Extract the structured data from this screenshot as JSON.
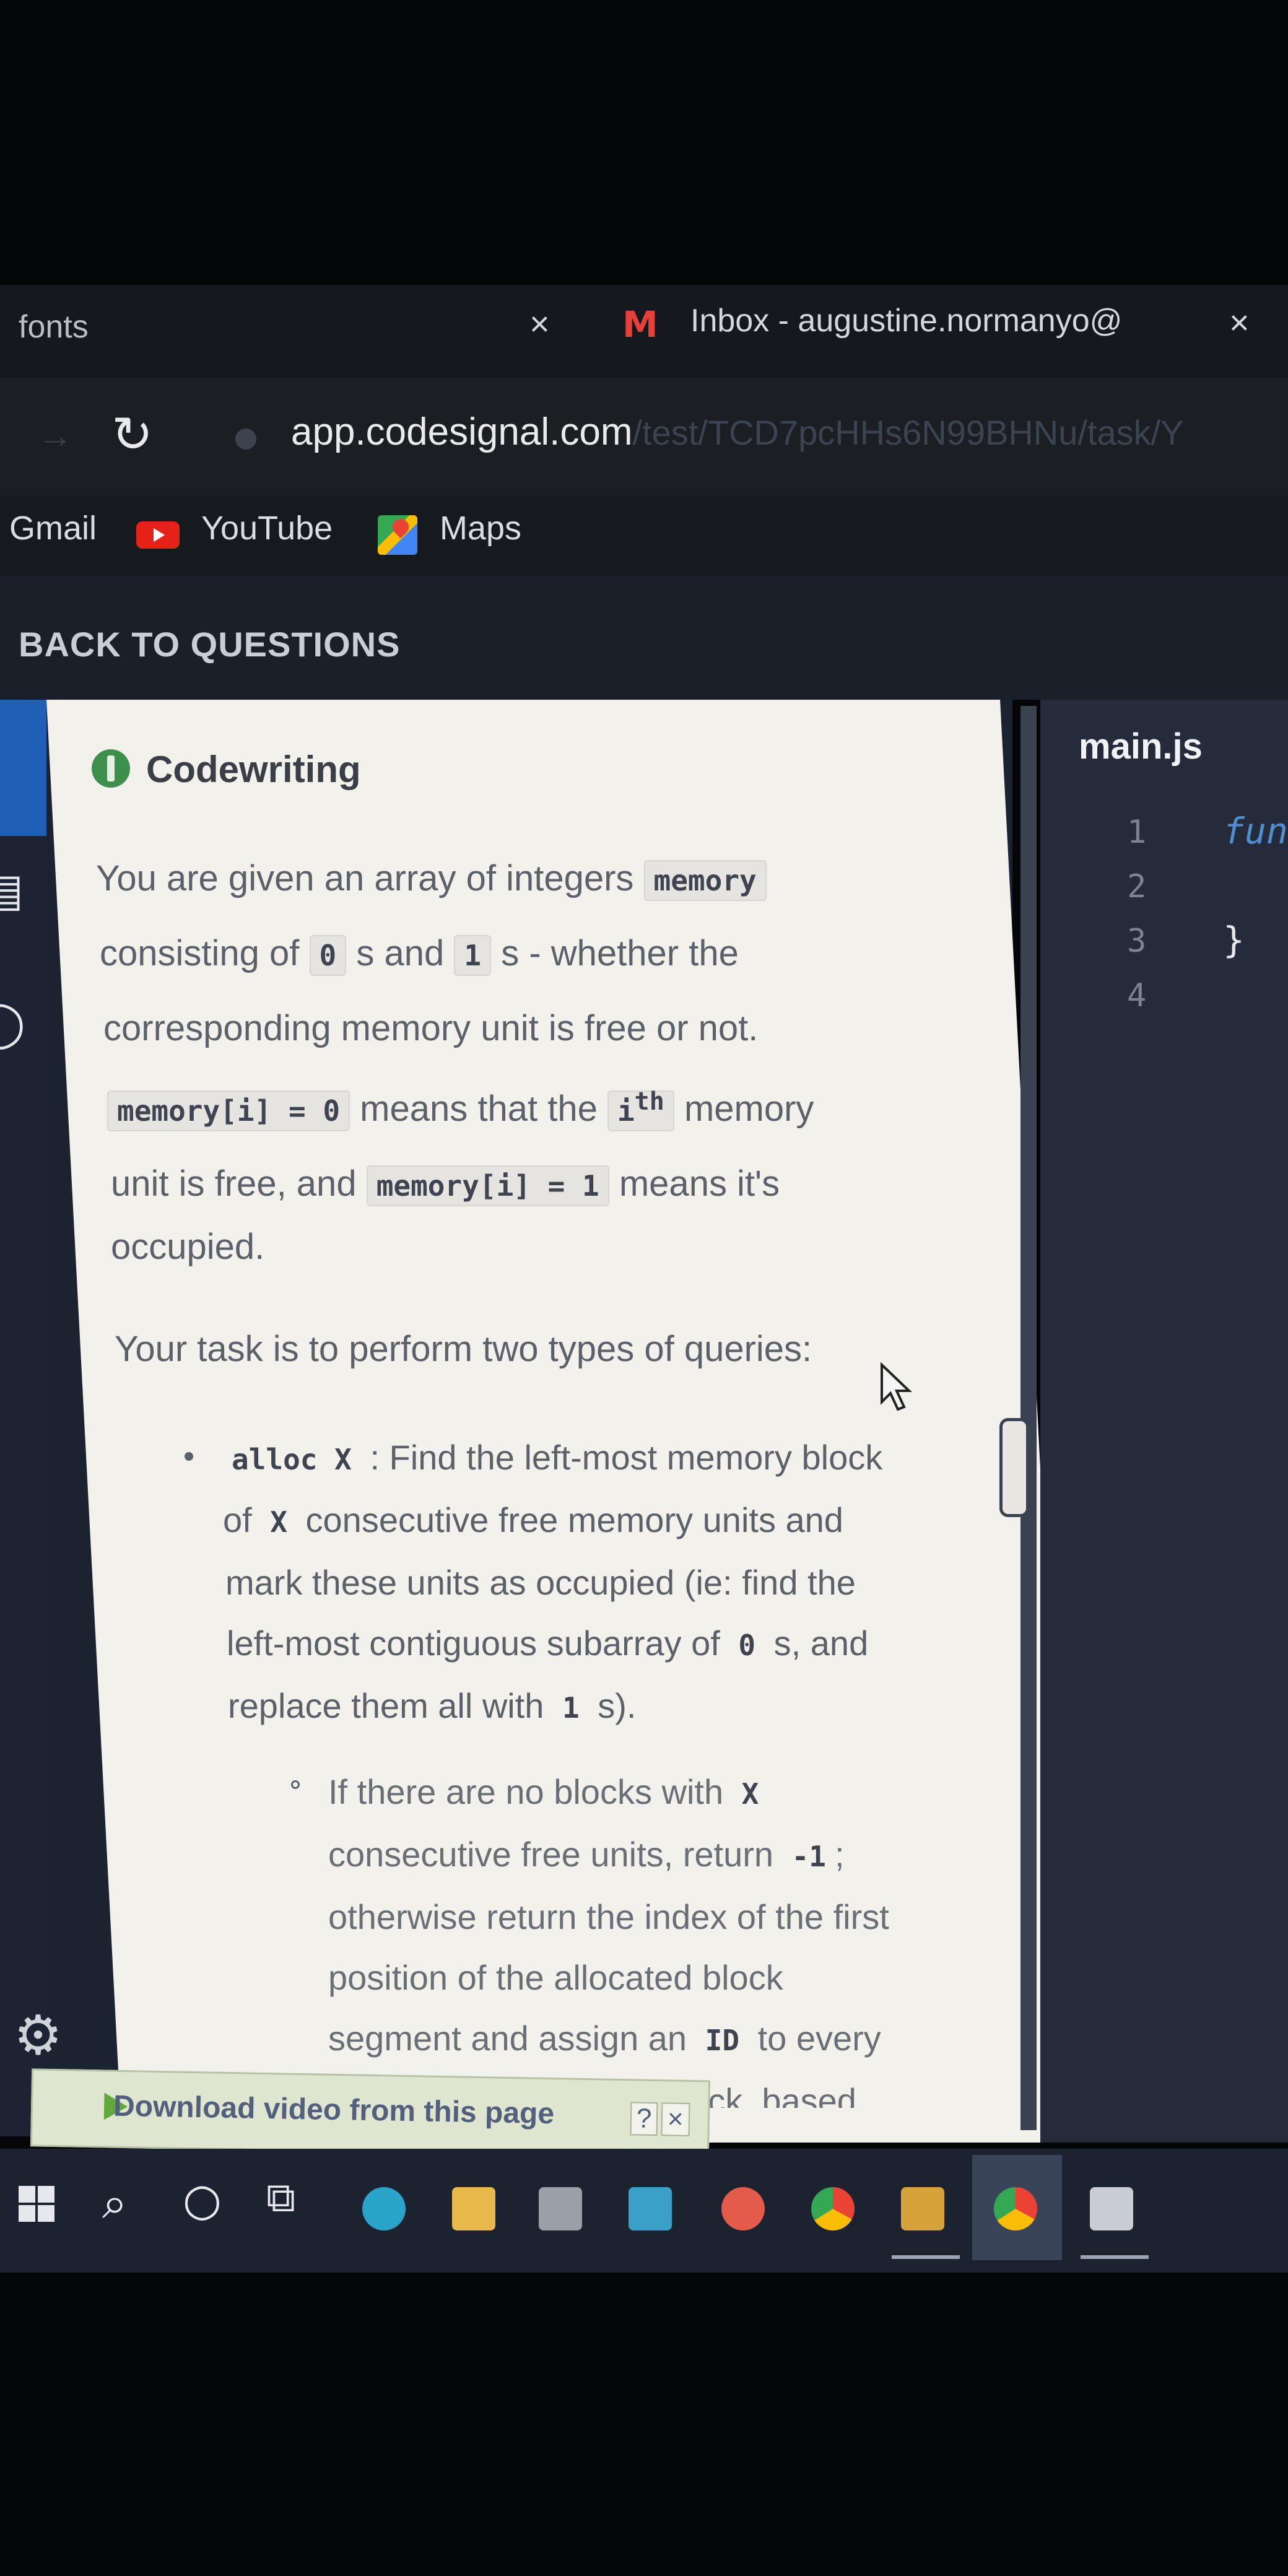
{
  "browser": {
    "tabs": [
      {
        "label": "fonts",
        "close": "×"
      },
      {
        "label": "Inbox - augustine.normanyo@",
        "close": "×"
      }
    ],
    "gmail_icon": "M",
    "url": {
      "host": "app.codesignal.com",
      "path": "/test/TCD7pcHHs6N99BHNu/task/Y"
    },
    "bookmarks": [
      "Gmail",
      "YouTube",
      "Maps"
    ]
  },
  "app": {
    "back_label": "BACK TO QUESTIONS",
    "task": {
      "title": "Codewriting",
      "p1": {
        "t1": "You are given an array of integers",
        "c1": "memory",
        "t2": "consisting of",
        "c2": "0",
        "t3": "s and",
        "c3": "1",
        "t4": "s - whether the",
        "t5": "corresponding memory unit is free or not.",
        "c4": "memory[i] = 0",
        "t6": "means that the",
        "c5": "i",
        "sup": "th",
        "t7": "memory",
        "t8": "unit is free, and",
        "c6": "memory[i] = 1",
        "t9": "means it's",
        "t10": "occupied."
      },
      "p2": "Your task is to perform two types of queries:",
      "li1": {
        "c1": "alloc X",
        "t1": ": Find the left-most memory block",
        "t2": "of",
        "c2": "X",
        "t3": "consecutive free memory units and",
        "t4": "mark these units as occupied (ie: find the",
        "t5": "left-most contiguous subarray of",
        "c3": "0",
        "t6": "s, and",
        "t7": "replace them all with",
        "c4": "1",
        "t8": "s)."
      },
      "sub1": {
        "t1": "If there are no blocks with",
        "c1": "X",
        "t2": "consecutive free units, return",
        "c2": "-1",
        "t3": ";",
        "t4": "otherwise return the index of the first",
        "t5": "position of the allocated block",
        "t6": "segment and assign an",
        "c3": "ID",
        "t7": "to every",
        "t8": "single element in this block, based"
      }
    },
    "editor": {
      "filename": "main.js",
      "line_numbers": [
        "1",
        "2",
        "3",
        "4"
      ],
      "lines": [
        "fun",
        "",
        "}",
        ""
      ]
    }
  },
  "download_bar": {
    "label": "Download video from this page",
    "help": "?",
    "close": "×"
  },
  "colors": {
    "accent": "#1f5fb5",
    "panel": "#f2f1ec",
    "editor": "#252b3a",
    "keyword": "#4f8fcf"
  }
}
